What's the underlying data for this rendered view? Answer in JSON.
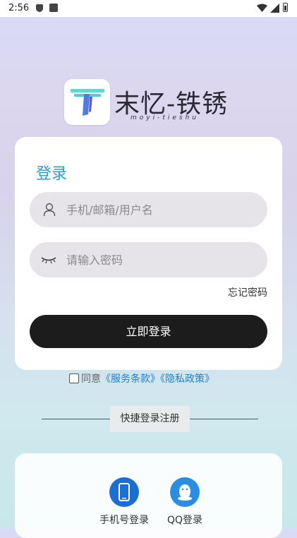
{
  "status_bar": {
    "time": "2:56"
  },
  "brand": {
    "title": "末忆-铁锈",
    "subtitle": "moyi-tieshu"
  },
  "login": {
    "title": "登录",
    "username_placeholder": "手机/邮箱/用户名",
    "password_placeholder": "请输入密码",
    "forgot_label": "忘记密码",
    "submit_label": "立即登录"
  },
  "agreement": {
    "prefix": "同意",
    "terms_link": "《服务条款》",
    "privacy_link": "《隐私政策》",
    "checked": false
  },
  "quick": {
    "label": "快捷登录注册"
  },
  "alt_login": [
    {
      "label": "手机号登录",
      "icon": "phone-icon"
    },
    {
      "label": "QQ登录",
      "icon": "qq-icon"
    }
  ],
  "colors": {
    "accent": "#24a0d8",
    "button": "#1c1c1c",
    "link": "#1f7fd0",
    "phone_icon_bg": "#1a6fd1",
    "qq_icon_bg": "#2a8ce3"
  }
}
